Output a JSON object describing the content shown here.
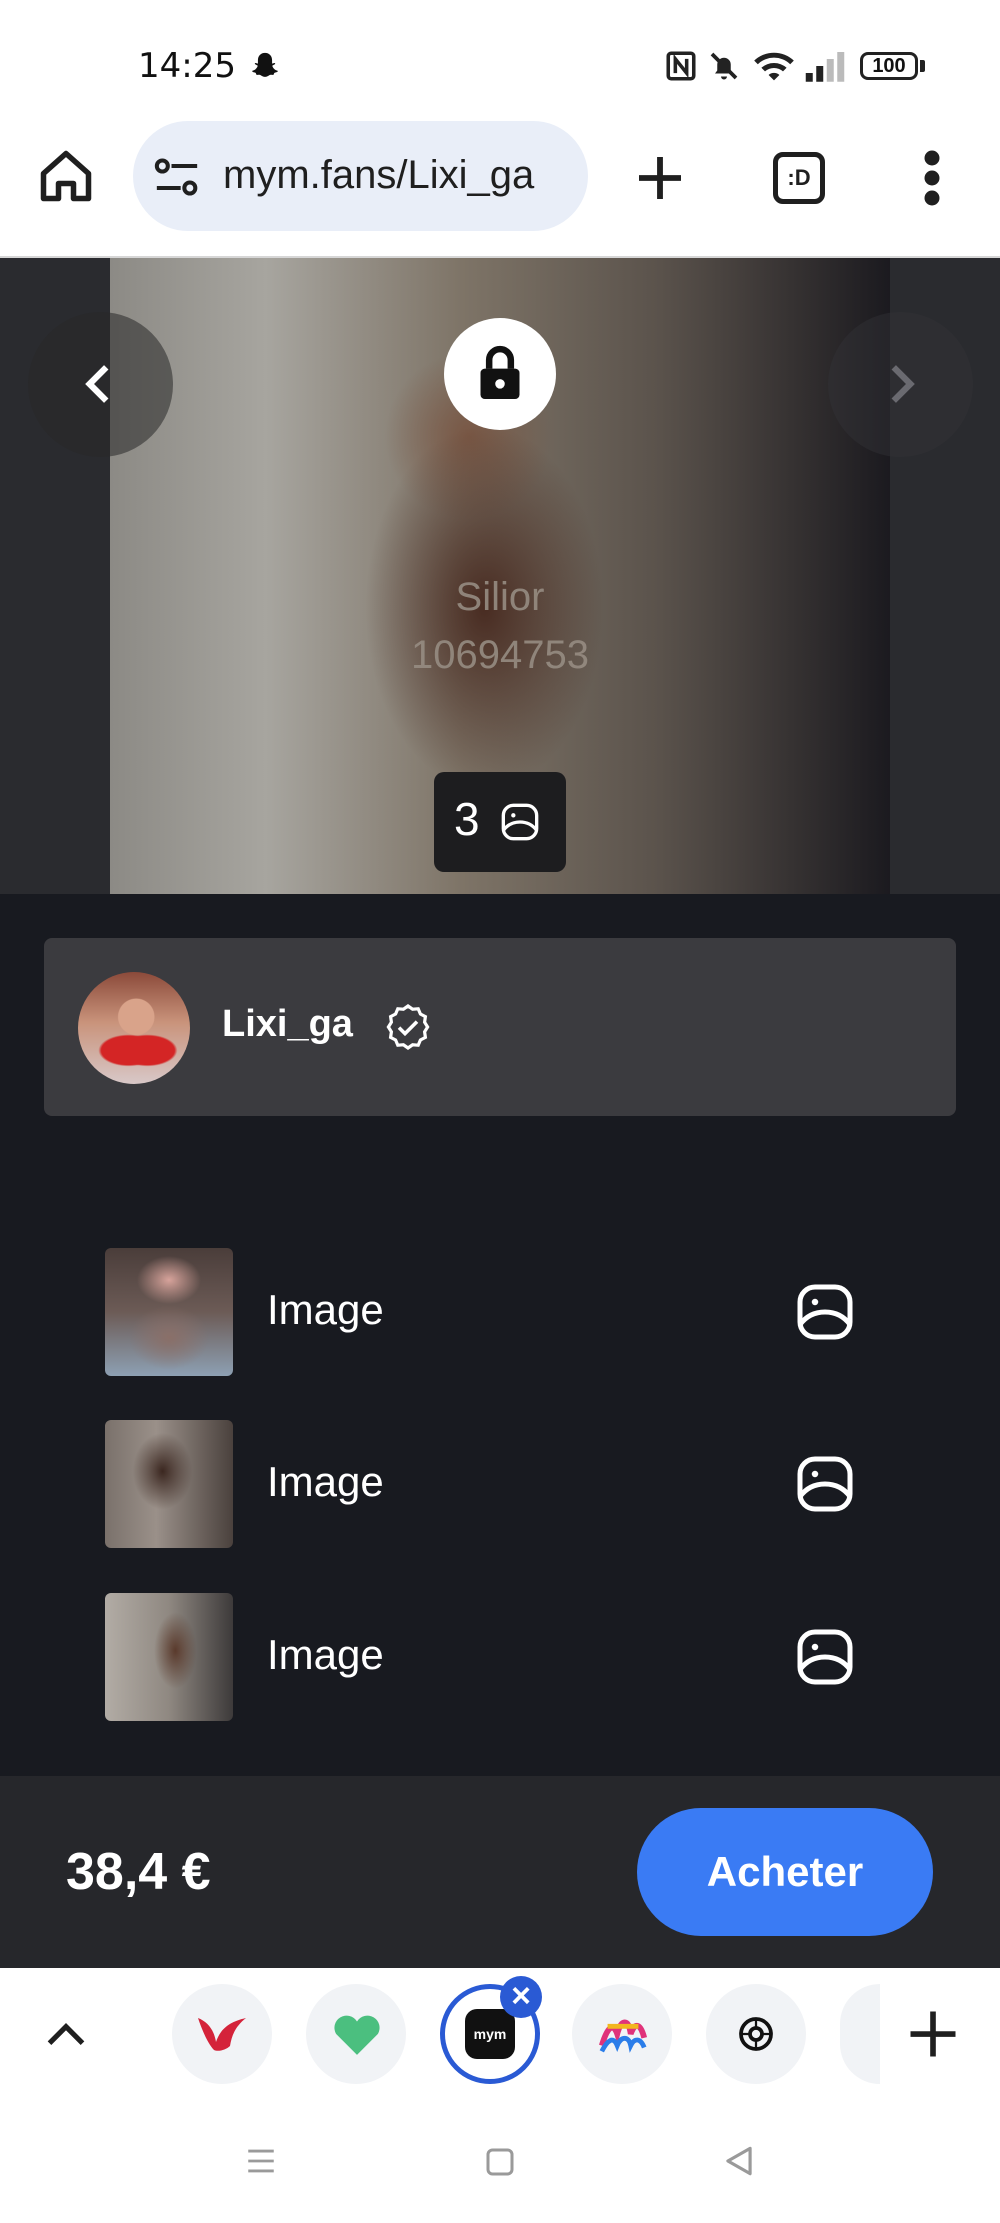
{
  "status_bar": {
    "time": "14:25",
    "battery": "100"
  },
  "browser": {
    "url": "mym.fans/Lixi_ga",
    "tabs_label": ":D"
  },
  "media": {
    "watermark_line1": "Silior",
    "watermark_line2": "10694753",
    "image_count": "3"
  },
  "creator": {
    "name": "Lixi_ga",
    "verified": true
  },
  "items": [
    {
      "label": "Image"
    },
    {
      "label": "Image"
    },
    {
      "label": "Image"
    }
  ],
  "purchase": {
    "price": "38,4 €",
    "button_label": "Acheter"
  },
  "tab_strip": {
    "active_tab_label": "mym"
  },
  "colors": {
    "accent": "#3a7bf4",
    "background": "#181a20",
    "card": "#3b3b3f",
    "tab_active": "#2a5ad4"
  }
}
